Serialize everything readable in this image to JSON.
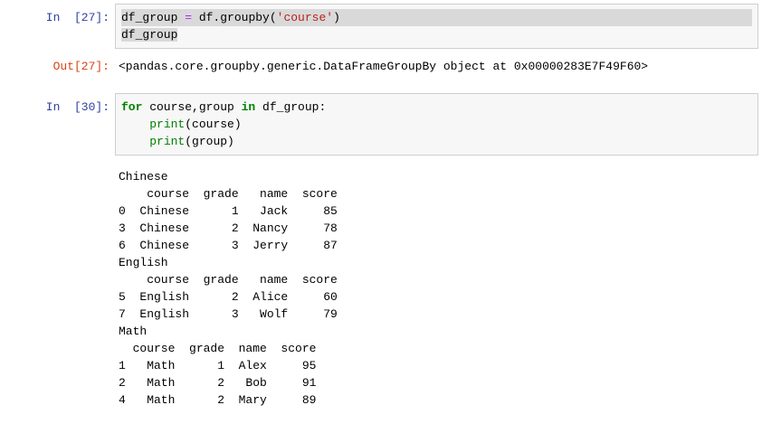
{
  "colors": {
    "in_prompt": "#303f9f",
    "out_prompt": "#d84315",
    "keyword": "#008000",
    "builtin": "#008000",
    "string": "#ba2121",
    "operator": "#aa22ff",
    "code_text": "#000000",
    "cell_bg": "#f7f7f7",
    "cell_border": "#cfcfcf",
    "selection": "#d9d9d9",
    "page_bg": "#ffffff"
  },
  "cells": {
    "in27": {
      "prompt": "In  [27]:",
      "lines": [
        {
          "highlight": "line",
          "tokens": [
            [
              "plain",
              "df_group "
            ],
            [
              "op",
              "="
            ],
            [
              "plain",
              " df.groupby("
            ],
            [
              "str",
              "'course'"
            ],
            [
              "plain",
              ")"
            ]
          ]
        },
        {
          "highlight": "text",
          "tokens": [
            [
              "plain",
              "df_group"
            ]
          ]
        }
      ]
    },
    "out27": {
      "prompt": "Out[27]:",
      "text": "<pandas.core.groupby.generic.DataFrameGroupBy object at 0x00000283E7F49F60>"
    },
    "in30": {
      "prompt": "In  [30]:",
      "lines": [
        {
          "tokens": [
            [
              "kw",
              "for"
            ],
            [
              "plain",
              " course,group "
            ],
            [
              "kw",
              "in"
            ],
            [
              "plain",
              " df_group:"
            ]
          ]
        },
        {
          "tokens": [
            [
              "plain",
              "    "
            ],
            [
              "builtin",
              "print"
            ],
            [
              "plain",
              "(course)"
            ]
          ]
        },
        {
          "tokens": [
            [
              "plain",
              "    "
            ],
            [
              "builtin",
              "print"
            ],
            [
              "plain",
              "(group)"
            ]
          ]
        }
      ]
    },
    "out30": {
      "lines": [
        "Chinese",
        "    course  grade   name  score",
        "0  Chinese      1   Jack     85",
        "3  Chinese      2  Nancy     78",
        "6  Chinese      3  Jerry     87",
        "English",
        "    course  grade   name  score",
        "5  English      2  Alice     60",
        "7  English      3   Wolf     79",
        "Math",
        "  course  grade  name  score",
        "1   Math      1  Alex     95",
        "2   Math      2   Bob     91",
        "4   Math      2  Mary     89"
      ],
      "tables": [
        {
          "group": "Chinese",
          "columns": [
            "",
            "course",
            "grade",
            "name",
            "score"
          ],
          "rows": [
            [
              "0",
              "Chinese",
              "1",
              "Jack",
              "85"
            ],
            [
              "3",
              "Chinese",
              "2",
              "Nancy",
              "78"
            ],
            [
              "6",
              "Chinese",
              "3",
              "Jerry",
              "87"
            ]
          ]
        },
        {
          "group": "English",
          "columns": [
            "",
            "course",
            "grade",
            "name",
            "score"
          ],
          "rows": [
            [
              "5",
              "English",
              "2",
              "Alice",
              "60"
            ],
            [
              "7",
              "English",
              "3",
              "Wolf",
              "79"
            ]
          ]
        },
        {
          "group": "Math",
          "columns": [
            "",
            "course",
            "grade",
            "name",
            "score"
          ],
          "rows": [
            [
              "1",
              "Math",
              "1",
              "Alex",
              "95"
            ],
            [
              "2",
              "Math",
              "2",
              "Bob",
              "91"
            ],
            [
              "4",
              "Math",
              "2",
              "Mary",
              "89"
            ]
          ]
        }
      ]
    }
  }
}
